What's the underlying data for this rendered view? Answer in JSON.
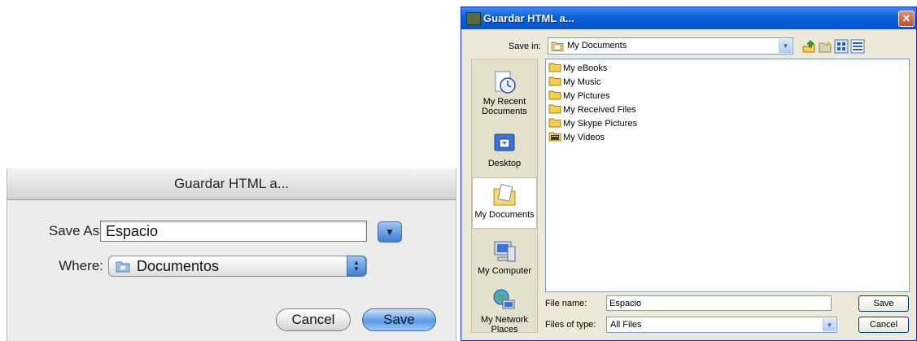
{
  "mac_dialog": {
    "title": "Guardar HTML a...",
    "save_as_label": "Save As:",
    "save_as_value": "Espacio",
    "where_label": "Where:",
    "where_value": "Documentos",
    "cancel_label": "Cancel",
    "save_label": "Save"
  },
  "xp_dialog": {
    "title": "Guardar HTML a...",
    "save_in_label": "Save in:",
    "save_in_value": "My Documents",
    "places": [
      {
        "label": "My Recent Documents",
        "icon": "recent-documents-icon"
      },
      {
        "label": "Desktop",
        "icon": "desktop-icon"
      },
      {
        "label": "My Documents",
        "icon": "my-documents-icon",
        "selected": true
      },
      {
        "label": "My Computer",
        "icon": "my-computer-icon"
      },
      {
        "label": "My Network Places",
        "icon": "network-places-icon"
      }
    ],
    "files": [
      {
        "name": "My eBooks",
        "icon": "folder-icon"
      },
      {
        "name": "My Music",
        "icon": "folder-icon"
      },
      {
        "name": "My Pictures",
        "icon": "folder-icon"
      },
      {
        "name": "My Received Files",
        "icon": "folder-icon"
      },
      {
        "name": "My Skype Pictures",
        "icon": "folder-icon"
      },
      {
        "name": "My Videos",
        "icon": "video-folder-icon"
      }
    ],
    "file_name_label": "File name:",
    "file_name_value": "Espacio",
    "files_of_type_label": "Files of type:",
    "files_of_type_value": "All Files",
    "save_label": "Save",
    "cancel_label": "Cancel"
  },
  "colors": {
    "xp_title_blue": "#0a5fd8",
    "xp_close_red": "#c74a29",
    "xp_face": "#ece9d8",
    "mac_aqua_blue": "#5a9ae6",
    "mac_sheet_gray": "#ececec"
  }
}
